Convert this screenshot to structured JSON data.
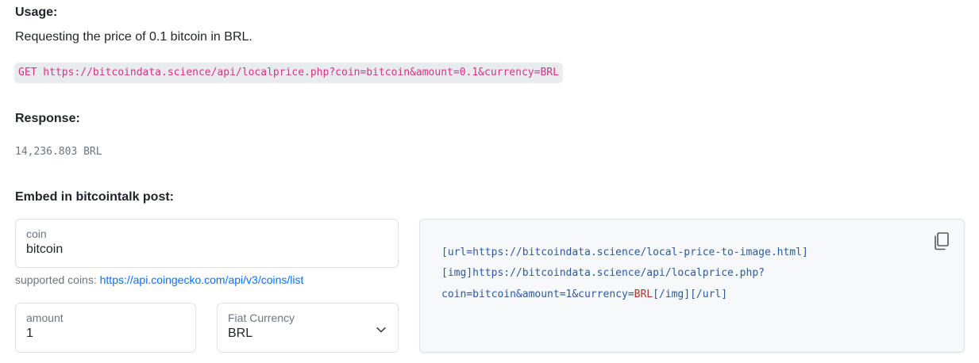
{
  "usage": {
    "heading": "Usage:",
    "description": "Requesting the price of 0.1 bitcoin in BRL.",
    "request": "GET https://bitcoindata.science/api/localprice.php?coin=bitcoin&amount=0.1&currency=BRL"
  },
  "response": {
    "heading": "Response:",
    "value": "14,236.803 BRL"
  },
  "embed": {
    "heading": "Embed in bitcointalk post:",
    "coin_field": {
      "label": "coin",
      "value": "bitcoin"
    },
    "supported_coins": {
      "prefix": "supported coins: ",
      "link_text": "https://api.coingecko.com/api/v3/coins/list"
    },
    "amount_field": {
      "label": "amount",
      "value": "1"
    },
    "currency_select": {
      "label": "Fiat Currency",
      "value": "BRL"
    },
    "code_lines": {
      "line1": "[url=https://bitcoindata.science/local-price-to-image.html]",
      "line2": "[img]https://bitcoindata.science/api/localprice.php?",
      "line3_a": "coin=bitcoin&amount=1&currency=",
      "line3_b": "BRL",
      "line3_c": "[/img][/url]"
    },
    "copy_icon": "copy-icon"
  },
  "colors": {
    "code_pink": "#d63384",
    "link_blue": "#0d6efd",
    "code_blue": "#2c5aa0",
    "code_red": "#b2302f"
  }
}
